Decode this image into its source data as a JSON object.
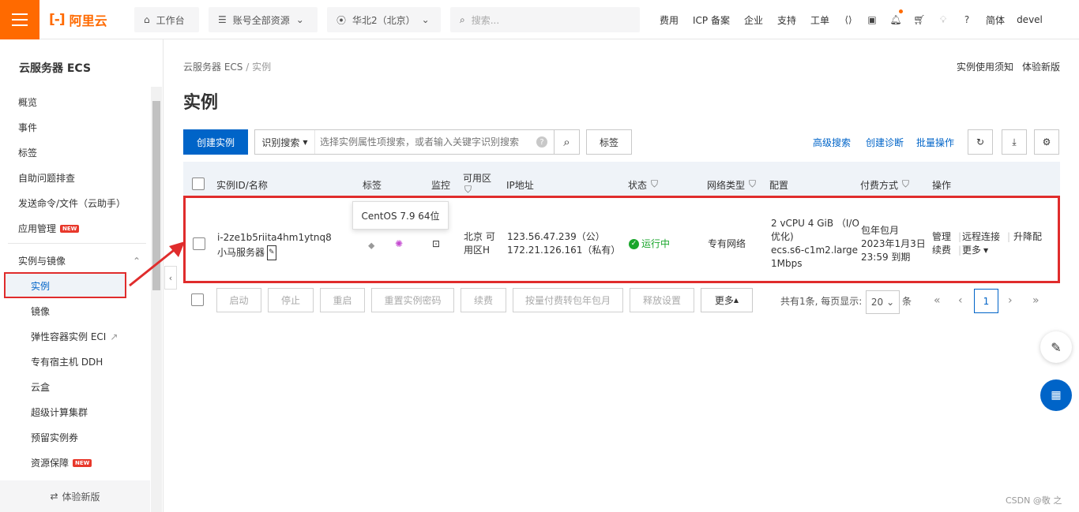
{
  "topbar": {
    "brand": "阿里云",
    "workbench": "工作台",
    "resources": "账号全部资源",
    "region": "华北2（北京）",
    "search_placeholder": "搜索...",
    "links": [
      "费用",
      "ICP 备案",
      "企业",
      "支持",
      "工单"
    ],
    "lang": "简体",
    "user": "devel"
  },
  "sidebar": {
    "title": "云服务器 ECS",
    "items": [
      "概览",
      "事件",
      "标签",
      "自助问题排查",
      "发送命令/文件（云助手）",
      "应用管理"
    ],
    "new_badge": "NEW",
    "group": "实例与镜像",
    "sub_items": [
      "实例",
      "镜像",
      "弹性容器实例 ECI",
      "专有宿主机 DDH",
      "云盒",
      "超级计算集群",
      "预留实例券",
      "资源保障"
    ],
    "footer": "体验新版"
  },
  "main": {
    "breadcrumb_root": "云服务器 ECS",
    "breadcrumb_sep": "/",
    "breadcrumb_current": "实例",
    "title": "实例",
    "top_links": [
      "实例使用须知",
      "体验新版"
    ],
    "create_button": "创建实例",
    "search_type": "识别搜索",
    "search_placeholder": "选择实例属性项搜索，或者输入关键字识别搜索",
    "tag_button": "标签",
    "advanced_search": "高级搜索",
    "create_diagnosis": "创建诊断",
    "batch_ops": "批量操作"
  },
  "table": {
    "headers": {
      "id": "实例ID/名称",
      "tags": "标签",
      "monitor": "监控",
      "zone": "可用区",
      "ip": "IP地址",
      "status": "状态",
      "network": "网络类型",
      "config": "配置",
      "billing": "付费方式",
      "ops": "操作"
    },
    "row": {
      "id": "i-2ze1b5riita4hm1ytnq8",
      "name": "小马服务器",
      "os_tooltip": "CentOS 7.9 64位",
      "zone_line1": "北京 可",
      "zone_line2": "用区H",
      "ip_public": "123.56.47.239（公）",
      "ip_private": "172.21.126.161（私有）",
      "status": "运行中",
      "network": "专有网络",
      "config_line1": "2 vCPU 4 GiB （I/O",
      "config_line2": "优化)",
      "config_type": "ecs.s6-c1m2.large",
      "config_bw": "1Mbps",
      "billing_line1": "包年包月",
      "billing_line2": "2023年1月3日",
      "billing_line3": "23:59 到期",
      "op_manage": "管理",
      "op_remote": "远程连接",
      "op_upgrade": "升降配",
      "op_renew": "续费",
      "op_more": "更多"
    }
  },
  "actions": [
    "启动",
    "停止",
    "重启",
    "重置实例密码",
    "续费",
    "按量付费转包年包月",
    "释放设置"
  ],
  "more_button": "更多",
  "pagination": {
    "summary": "共有1条, 每页显示:",
    "page_size": "20",
    "unit": "条",
    "current": "1"
  },
  "watermark": "CSDN @敬 之",
  "colors": {
    "brand": "#ff6a00",
    "primary": "#0064c8",
    "highlight": "#e02c2c",
    "running": "#19a62b"
  }
}
